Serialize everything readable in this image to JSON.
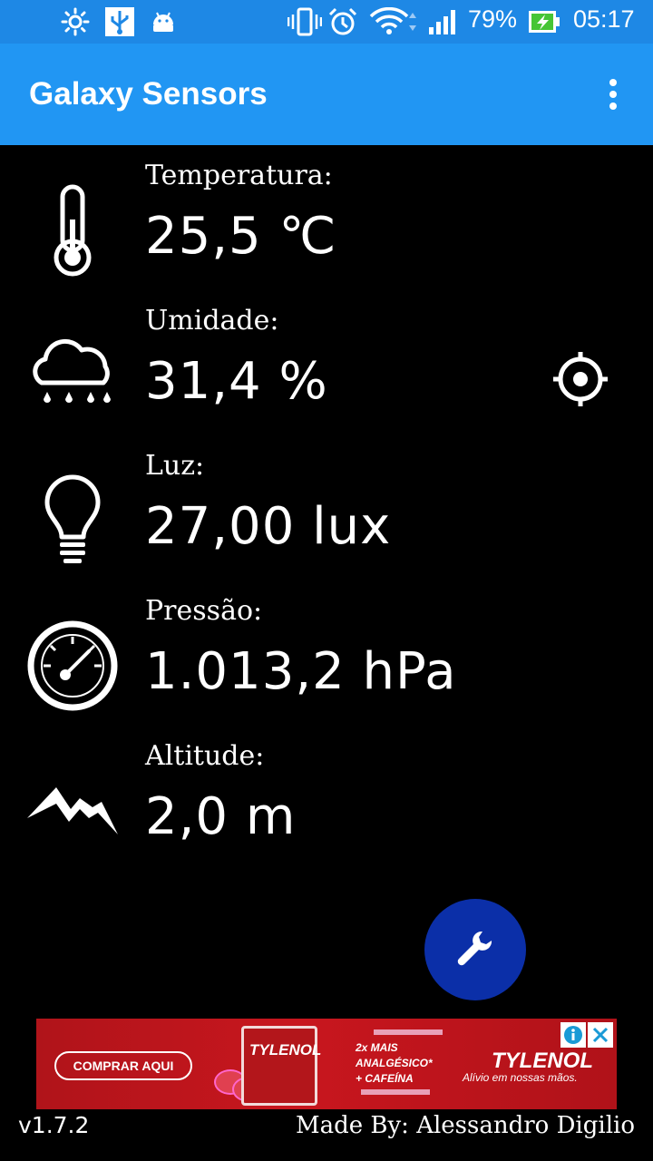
{
  "status_bar": {
    "icons": [
      "moon-icon",
      "brightness-icon",
      "usb-icon",
      "android-icon",
      "vibrate-icon",
      "alarm-icon",
      "wifi-icon",
      "signal-icon",
      "battery-charging-icon"
    ],
    "battery_percent": "79%",
    "time": "05:17"
  },
  "app_bar": {
    "title": "Galaxy Sensors",
    "menu_icon": "overflow-menu-icon"
  },
  "sensors": [
    {
      "label": "Temperatura:",
      "value": "25,5 ℃",
      "icon": "thermometer-icon"
    },
    {
      "label": "Umidade:",
      "value": "31,4 %",
      "icon": "rain-cloud-icon"
    },
    {
      "label": "Luz:",
      "value": "27,00 lux",
      "icon": "lightbulb-icon"
    },
    {
      "label": "Pressão:",
      "value": "1.013,2 hPa",
      "icon": "gauge-icon"
    },
    {
      "label": "Altitude:",
      "value": "2,0 m",
      "icon": "mountain-icon"
    }
  ],
  "light_action_icon": "target-icon",
  "fab_icon": "wrench-icon",
  "ad": {
    "cta": "COMPRAR AQUI",
    "box_brand": "TYLENOL",
    "promo_line1": "2x MAIS",
    "promo_line2": "ANALGÉSICO*",
    "promo_line3": "+ CAFEÍNA",
    "brand": "TYLENOL",
    "tagline": "Alívio em nossas mãos.",
    "colors": {
      "background": "#c8161e",
      "accent": "#e8a0b8"
    }
  },
  "footer": {
    "version": "v1.7.2",
    "credit": "Made By: Alessandro Digilio"
  },
  "colors": {
    "status_bar": "#1e88e5",
    "app_bar": "#2196f3",
    "background": "#000000",
    "fab": "#0b2fa8"
  }
}
